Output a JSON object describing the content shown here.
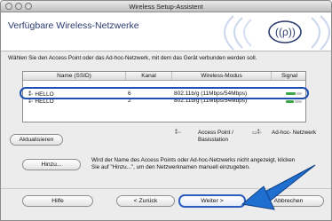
{
  "window": {
    "title": "Wireless Setup-Assistent"
  },
  "header": {
    "title": "Verfügbare Wireless-Netzwerke"
  },
  "instruction": "Wählen Sie den Access Point oder das Ad-hoc-Netzwerk, mit dem das Gerät verbunden werden soll.",
  "table": {
    "columns": [
      "Name (SSID)",
      "Kanal",
      "Wireless-Modus",
      "Signal"
    ],
    "rows": [
      {
        "ssid": "HELLO",
        "channel": "6",
        "mode": "802.11b/g (11Mbps/54Mbps)",
        "signal_level": 0.6,
        "selected": true
      },
      {
        "ssid": "HELLO",
        "channel": "2",
        "mode": "802.11b/g (11Mbps/54Mbps)",
        "signal_level": 0.5,
        "selected": false
      }
    ]
  },
  "buttons": {
    "refresh": "Aktualisieren",
    "add": "Hinzu...",
    "help": "Hilfe",
    "back": "< Zurück",
    "next": "Weiter >",
    "cancel": "Abbrechen"
  },
  "legend": {
    "ap_label": "Access Point /\nBasisstation",
    "adhoc_label": "Ad-hoc- Netzwerk"
  },
  "info": "Wird der Name des Access Points oder Ad-hoc-Netzwerks nicht angezeigt, klicken Sie auf \"Hinzu...\", um den Netzwerknamen manuell einzugeben.",
  "colors": {
    "accent": "#1f4fb0",
    "signal": "#3aa64a",
    "arrow": "#1f6fd0",
    "header_title": "#2a3b6e"
  }
}
